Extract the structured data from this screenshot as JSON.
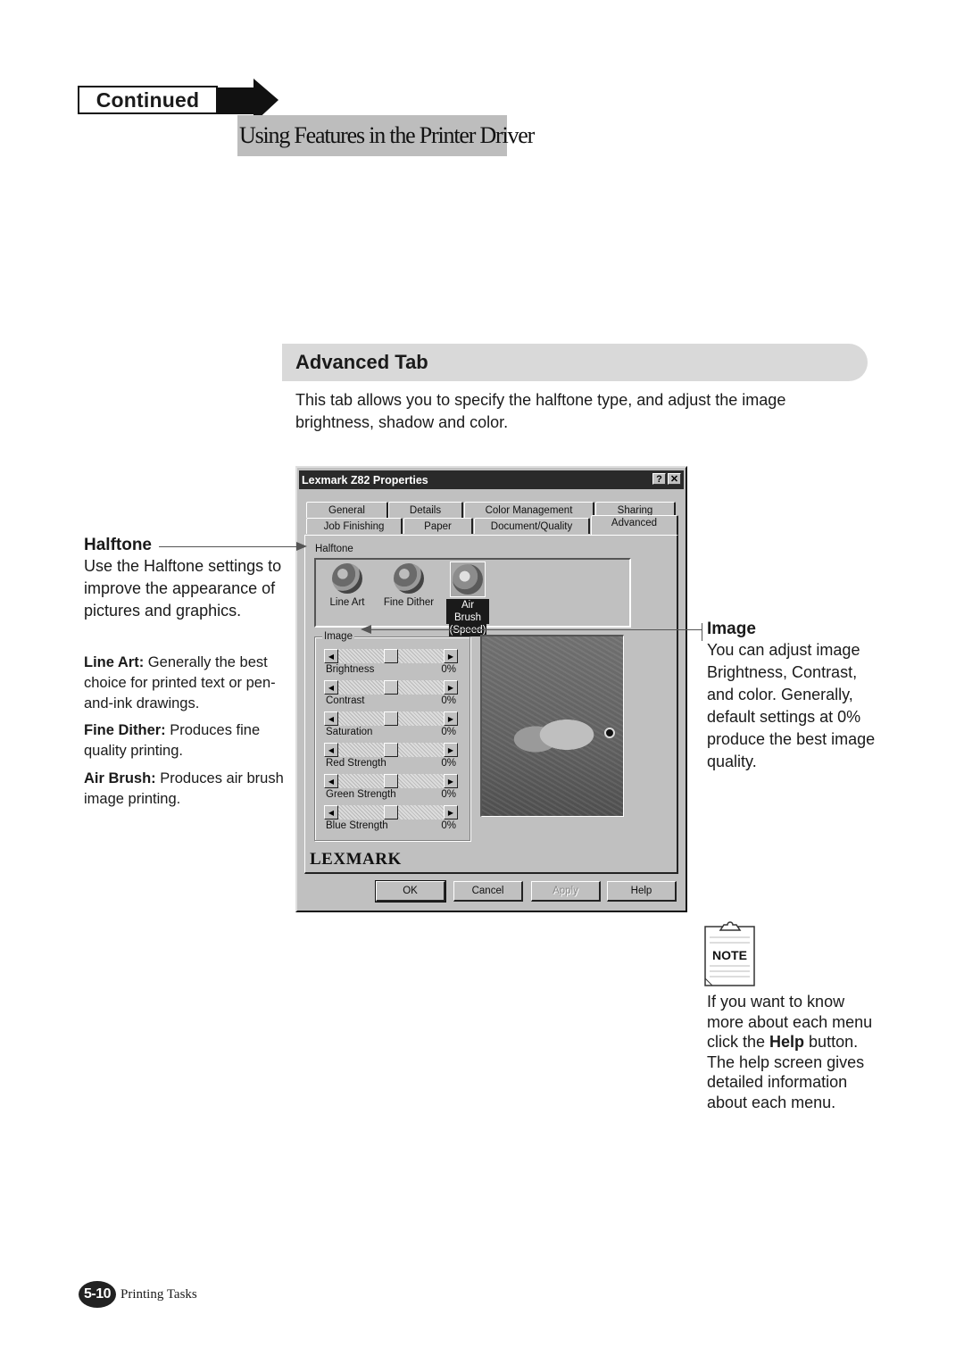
{
  "header": {
    "continued_label": "Continued",
    "section_title": "Using Features in the Printer Driver"
  },
  "section": {
    "heading": "Advanced Tab",
    "description": "This tab allows you to specify the halftone type, and adjust the image brightness, shadow and color."
  },
  "dialog": {
    "title": "Lexmark Z82 Properties",
    "help_button": "?",
    "close_button": "✕",
    "tabs_row1": [
      {
        "label": "General"
      },
      {
        "label": "Details"
      },
      {
        "label": "Color Management"
      },
      {
        "label": "Sharing"
      }
    ],
    "tabs_row2": [
      {
        "label": "Job Finishing"
      },
      {
        "label": "Paper"
      },
      {
        "label": "Document/Quality"
      },
      {
        "label": "Advanced",
        "active": true
      }
    ],
    "halftone": {
      "group_label": "Halftone",
      "options": [
        {
          "label": "Line Art",
          "sublabel": ""
        },
        {
          "label": "Fine Dither",
          "sublabel": ""
        },
        {
          "label": "Air Brush",
          "sublabel": "(Speed)",
          "selected": true
        }
      ]
    },
    "image": {
      "group_label": "Image",
      "sliders": [
        {
          "label": "Brightness",
          "value": "0%",
          "position": 0.5
        },
        {
          "label": "Contrast",
          "value": "0%",
          "position": 0.5
        },
        {
          "label": "Saturation",
          "value": "0%",
          "position": 0.5
        },
        {
          "label": "Red Strength",
          "value": "0%",
          "position": 0.5
        },
        {
          "label": "Green Strength",
          "value": "0%",
          "position": 0.5
        },
        {
          "label": "Blue Strength",
          "value": "0%",
          "position": 0.5
        }
      ]
    },
    "logo": "LEXMARK",
    "buttons": {
      "ok": "OK",
      "cancel": "Cancel",
      "apply": "Apply",
      "help": "Help"
    }
  },
  "callouts": {
    "halftone": {
      "title": "Halftone",
      "body": "Use the Halftone settings to improve the appearance of pictures and graphics."
    },
    "line_art": {
      "term": "Line Art:",
      "text": " Generally the best choice for printed text or pen-and-ink drawings."
    },
    "fine_dither": {
      "term": "Fine Dither:",
      "text": " Produces fine quality printing."
    },
    "air_brush": {
      "term": "Air Brush:",
      "text": " Produces air brush image printing."
    },
    "image": {
      "title": "Image",
      "body": "You can adjust image Brightness, Contrast, and color. Generally, default settings at 0% produce the best image quality."
    }
  },
  "note": {
    "icon_label": "NOTE",
    "text_before": "If you want to know more about each menu click the ",
    "text_bold": "Help",
    "text_after": " button. The help screen gives detailed information about each menu."
  },
  "footer": {
    "page_number": "5-10",
    "chapter": "Printing Tasks"
  }
}
